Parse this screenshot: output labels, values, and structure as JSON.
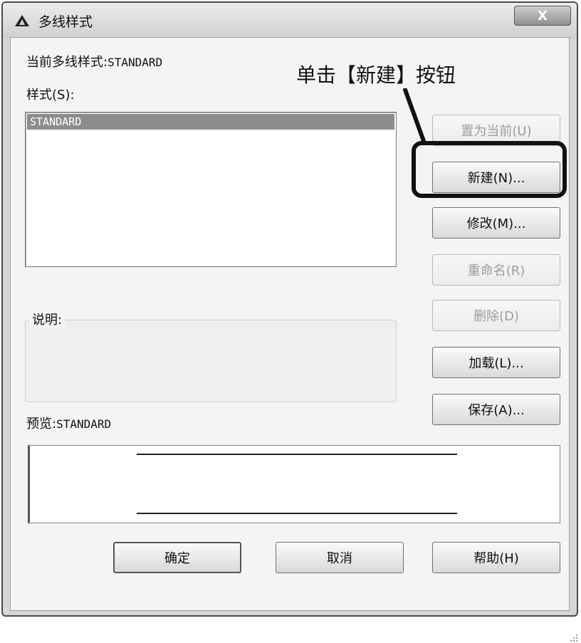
{
  "window": {
    "title": "多线样式",
    "close_label": "X"
  },
  "current_style": {
    "label": "当前多线样式:",
    "value": "STANDARD"
  },
  "styles": {
    "label": "样式(S):",
    "items": [
      "STANDARD"
    ],
    "selected_index": 0
  },
  "buttons": {
    "set_current": "置为当前(U)",
    "new": "新建(N)...",
    "modify": "修改(M)...",
    "rename": "重命名(R)",
    "delete": "删除(D)",
    "load": "加载(L)...",
    "save": "保存(A)..."
  },
  "description": {
    "label": "说明:",
    "value": ""
  },
  "preview": {
    "label": "预览:",
    "value": "STANDARD"
  },
  "footer": {
    "ok": "确定",
    "cancel": "取消",
    "help": "帮助(H)"
  },
  "annotation": {
    "text": "单击【新建】按钮"
  },
  "colors": {
    "selection": "#8c8c8c",
    "dialog_background": "#f4f4f4",
    "annotation": "#111111"
  }
}
